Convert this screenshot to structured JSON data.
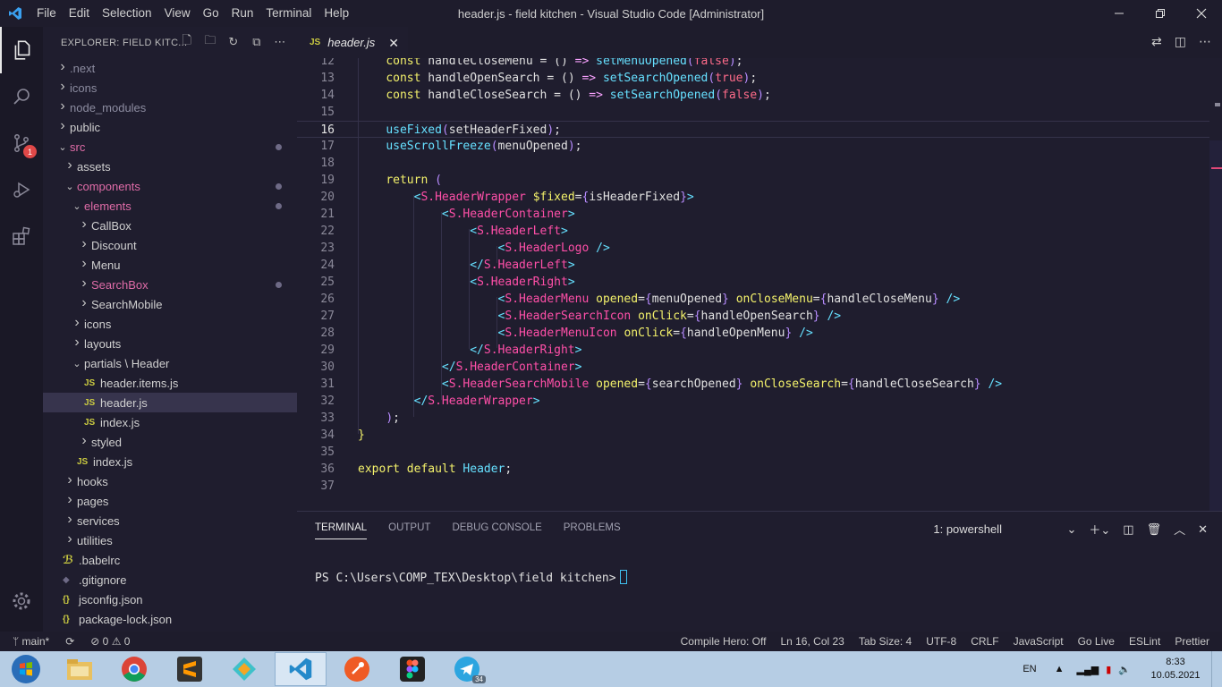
{
  "titlebar": {
    "menu": [
      "File",
      "Edit",
      "Selection",
      "View",
      "Go",
      "Run",
      "Terminal",
      "Help"
    ],
    "title": "header.js - field kitchen - Visual Studio Code [Administrator]"
  },
  "activity": {
    "scm_badge": "1"
  },
  "sidebar": {
    "header": "EXPLORER: FIELD KITC...",
    "tree": [
      {
        "label": ".next",
        "indent": 0,
        "type": "folder",
        "style": "dim"
      },
      {
        "label": "icons",
        "indent": 0,
        "type": "folder",
        "style": "dim"
      },
      {
        "label": "node_modules",
        "indent": 0,
        "type": "folder",
        "style": "dim"
      },
      {
        "label": "public",
        "indent": 0,
        "type": "folder"
      },
      {
        "label": "src",
        "indent": 0,
        "type": "folder-open",
        "style": "mod",
        "dot": true
      },
      {
        "label": "assets",
        "indent": 1,
        "type": "folder"
      },
      {
        "label": "components",
        "indent": 1,
        "type": "folder-open",
        "style": "mod",
        "dot": true
      },
      {
        "label": "elements",
        "indent": 2,
        "type": "folder-open",
        "style": "mod",
        "dot": true
      },
      {
        "label": "CallBox",
        "indent": 3,
        "type": "folder"
      },
      {
        "label": "Discount",
        "indent": 3,
        "type": "folder"
      },
      {
        "label": "Menu",
        "indent": 3,
        "type": "folder"
      },
      {
        "label": "SearchBox",
        "indent": 3,
        "type": "folder",
        "style": "mod",
        "dot": true
      },
      {
        "label": "SearchMobile",
        "indent": 3,
        "type": "folder"
      },
      {
        "label": "icons",
        "indent": 2,
        "type": "folder"
      },
      {
        "label": "layouts",
        "indent": 2,
        "type": "folder"
      },
      {
        "label": "partials \\ Header",
        "indent": 2,
        "type": "folder-open"
      },
      {
        "label": "header.items.js",
        "indent": 3,
        "type": "js"
      },
      {
        "label": "header.js",
        "indent": 3,
        "type": "js",
        "selected": true
      },
      {
        "label": "index.js",
        "indent": 3,
        "type": "js"
      },
      {
        "label": "styled",
        "indent": 3,
        "type": "folder"
      },
      {
        "label": "index.js",
        "indent": 2,
        "type": "js"
      },
      {
        "label": "hooks",
        "indent": 1,
        "type": "folder"
      },
      {
        "label": "pages",
        "indent": 1,
        "type": "folder"
      },
      {
        "label": "services",
        "indent": 1,
        "type": "folder"
      },
      {
        "label": "utilities",
        "indent": 1,
        "type": "folder"
      },
      {
        "label": ".babelrc",
        "indent": 0,
        "type": "babel"
      },
      {
        "label": ".gitignore",
        "indent": 0,
        "type": "git"
      },
      {
        "label": "jsconfig.json",
        "indent": 0,
        "type": "json"
      },
      {
        "label": "package-lock.json",
        "indent": 0,
        "type": "json"
      }
    ]
  },
  "editor": {
    "tab_label": "header.js",
    "tab_icon": "JS",
    "current_line": 16,
    "lines": [
      {
        "n": "12",
        "html": "    <span class='kw2'>const</span> handleCloseMenu = () <span class='kw'>=&gt;</span> <span class='fn'>setMenuOpened</span><span class='br'>(</span><span class='bool'>false</span><span class='br'>)</span>;"
      },
      {
        "n": "13",
        "html": "    <span class='kw2'>const</span> handleOpenSearch = () <span class='kw'>=&gt;</span> <span class='fn'>setSearchOpened</span><span class='br'>(</span><span class='bool'>true</span><span class='br'>)</span>;"
      },
      {
        "n": "14",
        "html": "    <span class='kw2'>const</span> handleCloseSearch = () <span class='kw'>=&gt;</span> <span class='fn'>setSearchOpened</span><span class='br'>(</span><span class='bool'>false</span><span class='br'>)</span>;"
      },
      {
        "n": "15",
        "html": ""
      },
      {
        "n": "16",
        "html": "    <span class='fn'>useFixed</span><span class='br'>(</span>setHeaderFixed<span class='br'>)</span>;"
      },
      {
        "n": "17",
        "html": "    <span class='fn'>useScrollFreeze</span><span class='br'>(</span>menuOpened<span class='br'>)</span>;"
      },
      {
        "n": "18",
        "html": ""
      },
      {
        "n": "19",
        "html": "    <span class='kw2'>return</span> <span class='br'>(</span>"
      },
      {
        "n": "20",
        "html": "        <span class='fn'>&lt;</span><span class='tag'>S.HeaderWrapper</span> <span class='attr'>$fixed</span>=<span class='br'>{</span>isHeaderFixed<span class='br'>}</span><span class='fn'>&gt;</span>"
      },
      {
        "n": "21",
        "html": "            <span class='fn'>&lt;</span><span class='tag'>S.HeaderContainer</span><span class='fn'>&gt;</span>"
      },
      {
        "n": "22",
        "html": "                <span class='fn'>&lt;</span><span class='tag'>S.HeaderLeft</span><span class='fn'>&gt;</span>"
      },
      {
        "n": "23",
        "html": "                    <span class='fn'>&lt;</span><span class='tag'>S.HeaderLogo</span> <span class='fn'>/&gt;</span>"
      },
      {
        "n": "24",
        "html": "                <span class='fn'>&lt;/</span><span class='tag'>S.HeaderLeft</span><span class='fn'>&gt;</span>"
      },
      {
        "n": "25",
        "html": "                <span class='fn'>&lt;</span><span class='tag'>S.HeaderRight</span><span class='fn'>&gt;</span>"
      },
      {
        "n": "26",
        "html": "                    <span class='fn'>&lt;</span><span class='tag'>S.HeaderMenu</span> <span class='attr'>opened</span>=<span class='br'>{</span>menuOpened<span class='br'>}</span> <span class='attr'>onCloseMenu</span>=<span class='br'>{</span>handleCloseMenu<span class='br'>}</span> <span class='fn'>/&gt;</span>"
      },
      {
        "n": "27",
        "html": "                    <span class='fn'>&lt;</span><span class='tag'>S.HeaderSearchIcon</span> <span class='attr'>onClick</span>=<span class='br'>{</span>handleOpenSearch<span class='br'>}</span> <span class='fn'>/&gt;</span>"
      },
      {
        "n": "28",
        "html": "                    <span class='fn'>&lt;</span><span class='tag'>S.HeaderMenuIcon</span> <span class='attr'>onClick</span>=<span class='br'>{</span>handleOpenMenu<span class='br'>}</span> <span class='fn'>/&gt;</span>"
      },
      {
        "n": "29",
        "html": "                <span class='fn'>&lt;/</span><span class='tag'>S.HeaderRight</span><span class='fn'>&gt;</span>"
      },
      {
        "n": "30",
        "html": "            <span class='fn'>&lt;/</span><span class='tag'>S.HeaderContainer</span><span class='fn'>&gt;</span>"
      },
      {
        "n": "31",
        "html": "            <span class='fn'>&lt;</span><span class='tag'>S.HeaderSearchMobile</span> <span class='attr'>opened</span>=<span class='br'>{</span>searchOpened<span class='br'>}</span> <span class='attr'>onCloseSearch</span>=<span class='br'>{</span>handleCloseSearch<span class='br'>}</span> <span class='fn'>/&gt;</span>"
      },
      {
        "n": "32",
        "html": "        <span class='fn'>&lt;/</span><span class='tag'>S.HeaderWrapper</span><span class='fn'>&gt;</span>"
      },
      {
        "n": "33",
        "html": "    <span class='br'>)</span>;"
      },
      {
        "n": "34",
        "html": "<span class='kw2'>}</span>"
      },
      {
        "n": "35",
        "html": ""
      },
      {
        "n": "36",
        "html": "<span class='kw2'>export</span> <span class='kw2'>default</span> <span class='fn'>Header</span>;"
      },
      {
        "n": "37",
        "html": ""
      }
    ]
  },
  "panel": {
    "tabs": [
      "TERMINAL",
      "OUTPUT",
      "DEBUG CONSOLE",
      "PROBLEMS"
    ],
    "active_tab": "TERMINAL",
    "terminal_select": "1: powershell",
    "prompt": "PS C:\\Users\\COMP_TEX\\Desktop\\field kitchen>"
  },
  "status": {
    "branch": "main*",
    "problems": "⊘ 0 ⚠ 0",
    "compile_hero": "Compile Hero: Off",
    "position": "Ln 16, Col 23",
    "tab_size": "Tab Size: 4",
    "encoding": "UTF-8",
    "eol": "CRLF",
    "language": "JavaScript",
    "go_live": "Go Live",
    "eslint": "ESLint",
    "prettier": "Prettier"
  },
  "taskbar": {
    "lang": "EN",
    "time": "8:33",
    "date": "10.05.2021",
    "telegram_badge": "34"
  }
}
